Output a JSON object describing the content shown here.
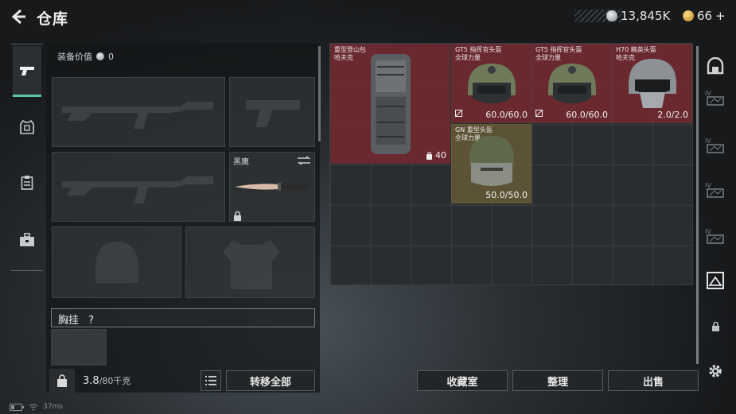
{
  "header": {
    "back_icon": "back-arrow-icon",
    "title": "仓库",
    "silver": "13,845K",
    "gold": "66",
    "gold_plus": "+",
    "colors": {
      "silver": "#bfc3c6",
      "gold": "#d9a63a"
    }
  },
  "left_tabs": [
    {
      "icon": "pistol-icon",
      "active": true
    },
    {
      "icon": "armor-icon",
      "active": false
    },
    {
      "icon": "clipboard-icon",
      "active": false
    },
    {
      "icon": "toolbox-icon",
      "active": false
    }
  ],
  "equipment": {
    "value_label": "装备价值",
    "value": "0",
    "knife_slot_name": "黑鹰",
    "chest_rig_label": "胸挂",
    "chest_rig_help": "?"
  },
  "footer_left": {
    "weight_current": "3.8",
    "weight_max": "/80千克",
    "transfer_all": "转移全部"
  },
  "stash_items": [
    {
      "name": "重型登山包\n哈夫克",
      "value": "40",
      "value_icon": "bag-icon",
      "bg": "red"
    },
    {
      "name": "GT5 指挥官头盔\n全球力量",
      "value": "60.0/60.0",
      "badge": "broken-icon",
      "bg": "red"
    },
    {
      "name": "GT5 指挥官头盔\n全球力量",
      "value": "60.0/60.0",
      "badge": "broken-icon",
      "bg": "red"
    },
    {
      "name": "H70 精英头盔\n哈夫克",
      "value": "2.0/2.0",
      "bg": "red"
    },
    {
      "name": "GN 重型头盔\n全球力量",
      "value": "50.0/50.0",
      "bg": "gold"
    }
  ],
  "bottom_buttons": {
    "collection": "收藏室",
    "sort": "整理",
    "sell": "出售"
  },
  "right_tabs": [
    {
      "icon": "vault-icon"
    },
    {
      "icon": "stash-tab-1-icon",
      "label": "IV"
    },
    {
      "icon": "stash-tab-2-icon",
      "label": "IV"
    },
    {
      "icon": "stash-tab-3-icon",
      "label": "IV"
    },
    {
      "icon": "stash-tab-4-icon",
      "label": "IV"
    },
    {
      "icon": "stash-expand-icon"
    },
    {
      "icon": "lock-icon"
    },
    {
      "icon": "settings-gear-icon"
    }
  ],
  "status_bar": {
    "ping": "37ms"
  }
}
